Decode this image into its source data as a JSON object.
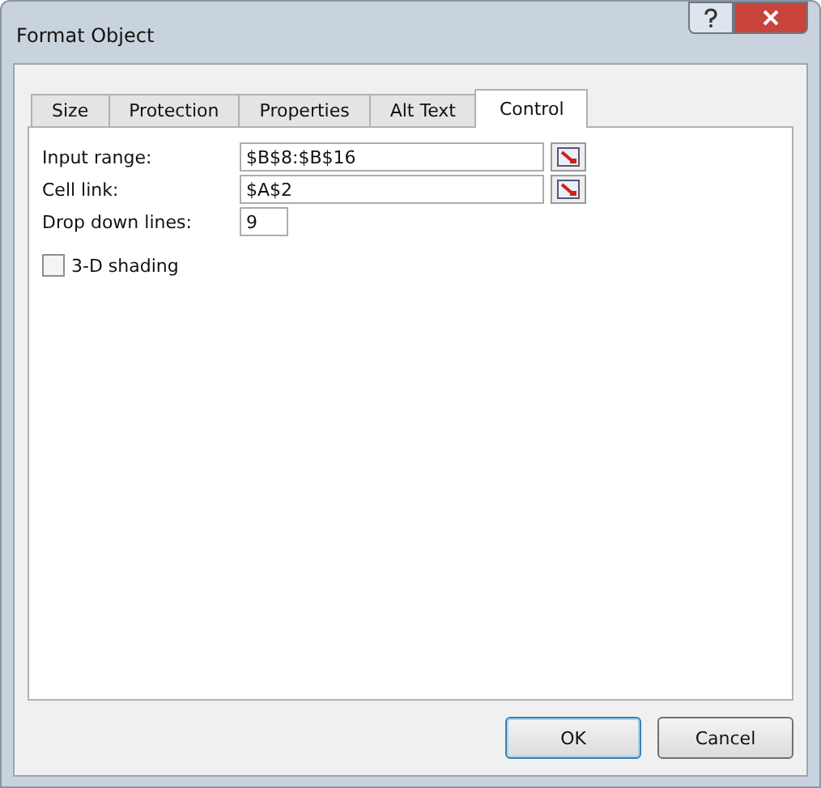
{
  "window": {
    "title": "Format Object"
  },
  "tabs": [
    {
      "label": "Size",
      "selected": false
    },
    {
      "label": "Protection",
      "selected": false
    },
    {
      "label": "Properties",
      "selected": false
    },
    {
      "label": "Alt Text",
      "selected": false
    },
    {
      "label": "Control",
      "selected": true
    }
  ],
  "fields": [
    {
      "kind": "range",
      "label": "Input range:",
      "value": "$B$8:$B$16"
    },
    {
      "kind": "range",
      "label": "Cell link:",
      "value": "$A$2"
    },
    {
      "kind": "short",
      "label": "Drop down lines:",
      "value": "9"
    }
  ],
  "checkbox": {
    "label": "3-D shading",
    "checked": false
  },
  "buttons": [
    "OK",
    "Cancel"
  ]
}
